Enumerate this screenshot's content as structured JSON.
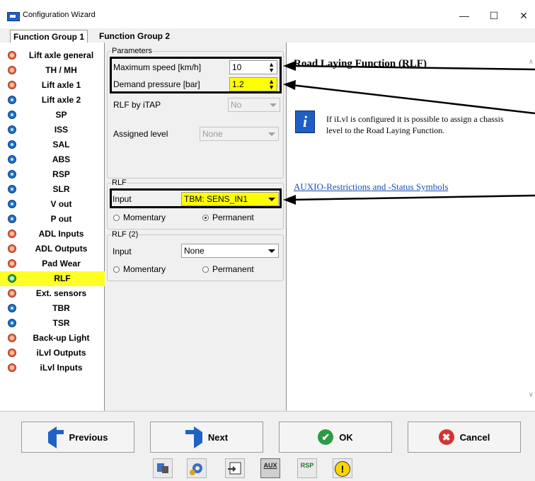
{
  "window": {
    "title": "Configuration Wizard",
    "minimize": "—",
    "maximize": "☐",
    "close": "✕"
  },
  "group_tabs": [
    "Function Group 1",
    "Function Group 2"
  ],
  "sidebar": {
    "items": [
      {
        "label": "Lift axle general",
        "status": "red"
      },
      {
        "label": "TH / MH",
        "status": "red"
      },
      {
        "label": "Lift axle 1",
        "status": "red"
      },
      {
        "label": "Lift axle 2",
        "status": "blue"
      },
      {
        "label": "SP",
        "status": "blue"
      },
      {
        "label": "ISS",
        "status": "blue"
      },
      {
        "label": "SAL",
        "status": "blue"
      },
      {
        "label": "ABS",
        "status": "blue"
      },
      {
        "label": "RSP",
        "status": "blue"
      },
      {
        "label": "SLR",
        "status": "blue"
      },
      {
        "label": "V out",
        "status": "blue"
      },
      {
        "label": "P out",
        "status": "blue"
      },
      {
        "label": "ADL Inputs",
        "status": "red"
      },
      {
        "label": "ADL Outputs",
        "status": "red"
      },
      {
        "label": "Pad Wear",
        "status": "red"
      },
      {
        "label": "RLF",
        "status": "green",
        "selected": true
      },
      {
        "label": "Ext. sensors",
        "status": "red"
      },
      {
        "label": "TBR",
        "status": "blue"
      },
      {
        "label": "TSR",
        "status": "blue"
      },
      {
        "label": "Back-up Light",
        "status": "red"
      },
      {
        "label": "iLvl Outputs",
        "status": "red"
      },
      {
        "label": "iLvl Inputs",
        "status": "red"
      }
    ]
  },
  "parameters": {
    "legend": "Parameters",
    "max_speed_label": "Maximum speed [km/h]",
    "max_speed_value": "10",
    "demand_pressure_label": "Demand pressure [bar]",
    "demand_pressure_value": "1.2",
    "rlf_by_itap_label": "RLF by iTAP",
    "rlf_by_itap_value": "No",
    "assigned_level_label": "Assigned level",
    "assigned_level_value": "None"
  },
  "rlf": {
    "legend": "RLF",
    "input_label": "Input",
    "input_value": "TBM: SENS_IN1",
    "momentary": "Momentary",
    "permanent": "Permanent",
    "selected_mode": "Permanent"
  },
  "rlf2": {
    "legend": "RLF (2)",
    "input_label": "Input",
    "input_value": "None",
    "momentary": "Momentary",
    "permanent": "Permanent"
  },
  "help": {
    "title": "Road Laying Function (RLF)",
    "info_icon": "i",
    "info_text": "If iLvl is configured it is possible to assign a chassis level to the Road Laying Function.",
    "link": "AUXIO-Restrictions and -Status Symbols"
  },
  "buttons": {
    "previous": "Previous",
    "next": "Next",
    "ok": "OK",
    "cancel": "Cancel"
  },
  "toolbar": {
    "aux": "AUX",
    "rsp": "RSP",
    "warning": "!"
  },
  "colors": {
    "selected_item": "#ffff26",
    "highlight_field": "#ffff00",
    "link": "#1a4fb5"
  }
}
